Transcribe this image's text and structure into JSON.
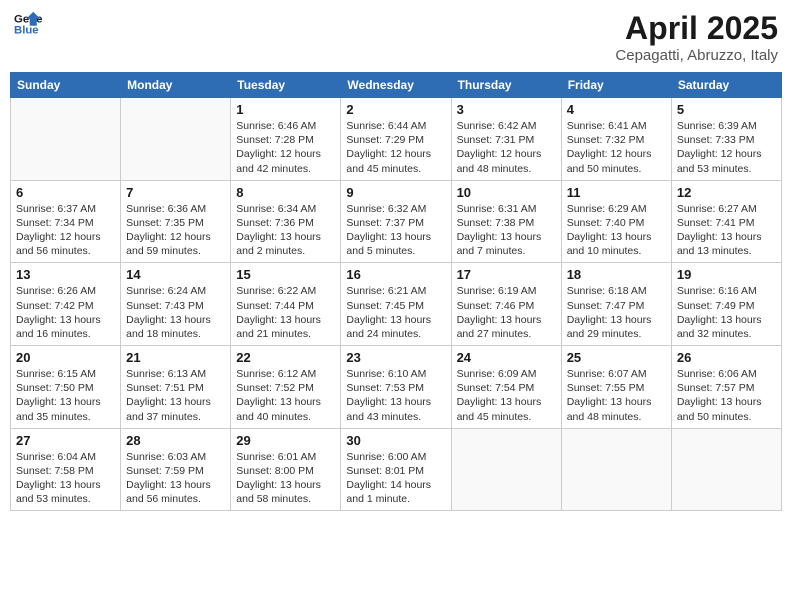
{
  "header": {
    "logo_line1": "General",
    "logo_line2": "Blue",
    "month": "April 2025",
    "location": "Cepagatti, Abruzzo, Italy"
  },
  "weekdays": [
    "Sunday",
    "Monday",
    "Tuesday",
    "Wednesday",
    "Thursday",
    "Friday",
    "Saturday"
  ],
  "weeks": [
    [
      {
        "day": "",
        "info": ""
      },
      {
        "day": "",
        "info": ""
      },
      {
        "day": "1",
        "info": "Sunrise: 6:46 AM\nSunset: 7:28 PM\nDaylight: 12 hours and 42 minutes."
      },
      {
        "day": "2",
        "info": "Sunrise: 6:44 AM\nSunset: 7:29 PM\nDaylight: 12 hours and 45 minutes."
      },
      {
        "day": "3",
        "info": "Sunrise: 6:42 AM\nSunset: 7:31 PM\nDaylight: 12 hours and 48 minutes."
      },
      {
        "day": "4",
        "info": "Sunrise: 6:41 AM\nSunset: 7:32 PM\nDaylight: 12 hours and 50 minutes."
      },
      {
        "day": "5",
        "info": "Sunrise: 6:39 AM\nSunset: 7:33 PM\nDaylight: 12 hours and 53 minutes."
      }
    ],
    [
      {
        "day": "6",
        "info": "Sunrise: 6:37 AM\nSunset: 7:34 PM\nDaylight: 12 hours and 56 minutes."
      },
      {
        "day": "7",
        "info": "Sunrise: 6:36 AM\nSunset: 7:35 PM\nDaylight: 12 hours and 59 minutes."
      },
      {
        "day": "8",
        "info": "Sunrise: 6:34 AM\nSunset: 7:36 PM\nDaylight: 13 hours and 2 minutes."
      },
      {
        "day": "9",
        "info": "Sunrise: 6:32 AM\nSunset: 7:37 PM\nDaylight: 13 hours and 5 minutes."
      },
      {
        "day": "10",
        "info": "Sunrise: 6:31 AM\nSunset: 7:38 PM\nDaylight: 13 hours and 7 minutes."
      },
      {
        "day": "11",
        "info": "Sunrise: 6:29 AM\nSunset: 7:40 PM\nDaylight: 13 hours and 10 minutes."
      },
      {
        "day": "12",
        "info": "Sunrise: 6:27 AM\nSunset: 7:41 PM\nDaylight: 13 hours and 13 minutes."
      }
    ],
    [
      {
        "day": "13",
        "info": "Sunrise: 6:26 AM\nSunset: 7:42 PM\nDaylight: 13 hours and 16 minutes."
      },
      {
        "day": "14",
        "info": "Sunrise: 6:24 AM\nSunset: 7:43 PM\nDaylight: 13 hours and 18 minutes."
      },
      {
        "day": "15",
        "info": "Sunrise: 6:22 AM\nSunset: 7:44 PM\nDaylight: 13 hours and 21 minutes."
      },
      {
        "day": "16",
        "info": "Sunrise: 6:21 AM\nSunset: 7:45 PM\nDaylight: 13 hours and 24 minutes."
      },
      {
        "day": "17",
        "info": "Sunrise: 6:19 AM\nSunset: 7:46 PM\nDaylight: 13 hours and 27 minutes."
      },
      {
        "day": "18",
        "info": "Sunrise: 6:18 AM\nSunset: 7:47 PM\nDaylight: 13 hours and 29 minutes."
      },
      {
        "day": "19",
        "info": "Sunrise: 6:16 AM\nSunset: 7:49 PM\nDaylight: 13 hours and 32 minutes."
      }
    ],
    [
      {
        "day": "20",
        "info": "Sunrise: 6:15 AM\nSunset: 7:50 PM\nDaylight: 13 hours and 35 minutes."
      },
      {
        "day": "21",
        "info": "Sunrise: 6:13 AM\nSunset: 7:51 PM\nDaylight: 13 hours and 37 minutes."
      },
      {
        "day": "22",
        "info": "Sunrise: 6:12 AM\nSunset: 7:52 PM\nDaylight: 13 hours and 40 minutes."
      },
      {
        "day": "23",
        "info": "Sunrise: 6:10 AM\nSunset: 7:53 PM\nDaylight: 13 hours and 43 minutes."
      },
      {
        "day": "24",
        "info": "Sunrise: 6:09 AM\nSunset: 7:54 PM\nDaylight: 13 hours and 45 minutes."
      },
      {
        "day": "25",
        "info": "Sunrise: 6:07 AM\nSunset: 7:55 PM\nDaylight: 13 hours and 48 minutes."
      },
      {
        "day": "26",
        "info": "Sunrise: 6:06 AM\nSunset: 7:57 PM\nDaylight: 13 hours and 50 minutes."
      }
    ],
    [
      {
        "day": "27",
        "info": "Sunrise: 6:04 AM\nSunset: 7:58 PM\nDaylight: 13 hours and 53 minutes."
      },
      {
        "day": "28",
        "info": "Sunrise: 6:03 AM\nSunset: 7:59 PM\nDaylight: 13 hours and 56 minutes."
      },
      {
        "day": "29",
        "info": "Sunrise: 6:01 AM\nSunset: 8:00 PM\nDaylight: 13 hours and 58 minutes."
      },
      {
        "day": "30",
        "info": "Sunrise: 6:00 AM\nSunset: 8:01 PM\nDaylight: 14 hours and 1 minute."
      },
      {
        "day": "",
        "info": ""
      },
      {
        "day": "",
        "info": ""
      },
      {
        "day": "",
        "info": ""
      }
    ]
  ]
}
